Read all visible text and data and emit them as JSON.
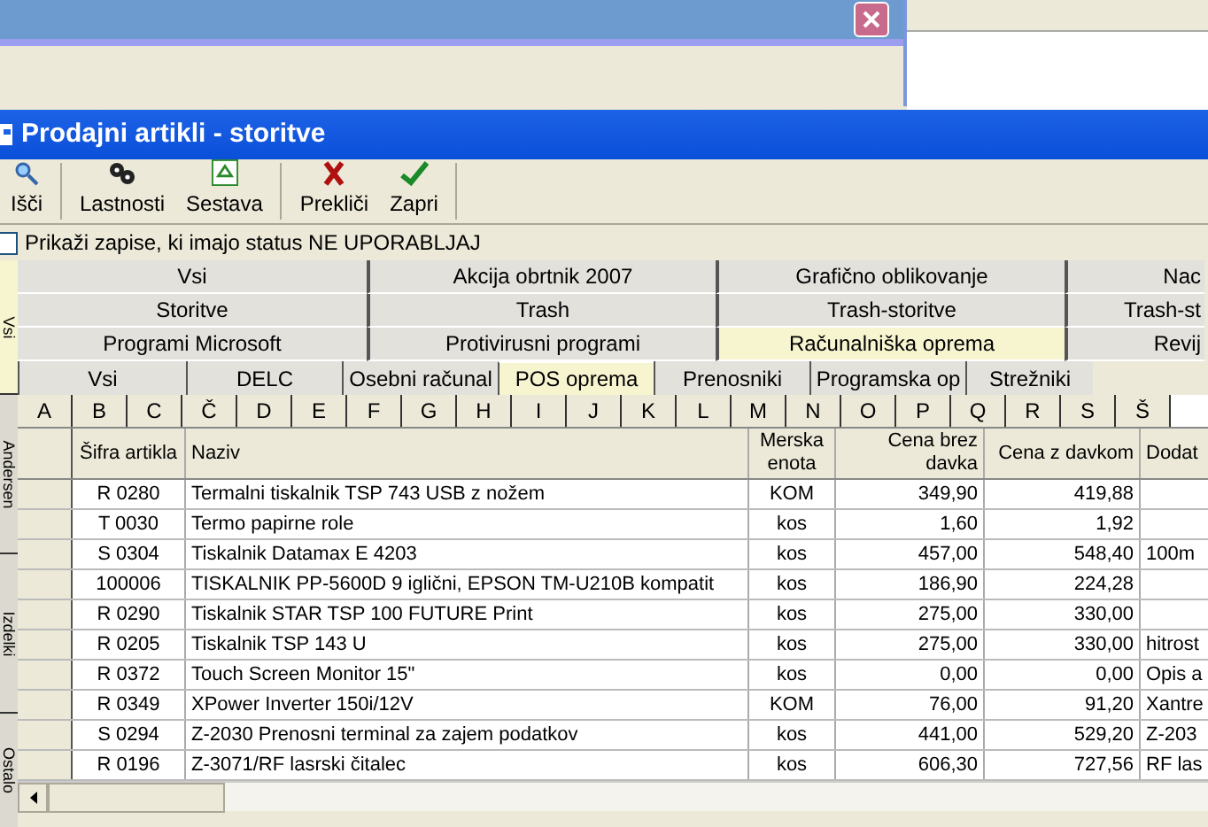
{
  "main_window": {
    "title": "Prodajni artikli - storitve"
  },
  "toolbar": [
    {
      "label": "Išči",
      "kind": "search"
    },
    {
      "label": "Lastnosti",
      "kind": "props"
    },
    {
      "label": "Sestava",
      "kind": "compose"
    },
    {
      "label": "Prekliči",
      "kind": "cancel"
    },
    {
      "label": "Zapri",
      "kind": "confirm"
    }
  ],
  "filter": {
    "label": "Prikaži zapise, ki imajo status NE UPORABLJAJ",
    "checked": false
  },
  "side_tabs": [
    {
      "label": "Vsi",
      "selected": true
    },
    {
      "label": "Andersen",
      "selected": false
    },
    {
      "label": "Izdelki",
      "selected": false
    },
    {
      "label": "Ostalo",
      "selected": false
    }
  ],
  "group_tabs": [
    [
      {
        "label": "Vsi",
        "selected": false
      },
      {
        "label": "Akcija obrtnik 2007",
        "selected": false
      },
      {
        "label": "Grafično oblikovanje",
        "selected": false
      },
      {
        "label": "Nac",
        "selected": false
      }
    ],
    [
      {
        "label": "Storitve",
        "selected": false
      },
      {
        "label": "Trash",
        "selected": false
      },
      {
        "label": "Trash-storitve",
        "selected": false
      },
      {
        "label": "Trash-st",
        "selected": false
      }
    ],
    [
      {
        "label": "Programi Microsoft",
        "selected": false
      },
      {
        "label": "Protivirusni programi",
        "selected": false
      },
      {
        "label": "Računalniška oprema",
        "selected": true
      },
      {
        "label": "Revij",
        "selected": false
      }
    ]
  ],
  "sub_tabs": [
    {
      "label": "Vsi",
      "selected": false
    },
    {
      "label": "DELC",
      "selected": false
    },
    {
      "label": "Osebni računal",
      "selected": false
    },
    {
      "label": "POS oprema",
      "selected": true
    },
    {
      "label": "Prenosniki",
      "selected": false
    },
    {
      "label": "Programska op",
      "selected": false
    },
    {
      "label": "Strežniki",
      "selected": false
    }
  ],
  "letters": [
    "A",
    "B",
    "C",
    "Č",
    "D",
    "E",
    "F",
    "G",
    "H",
    "I",
    "J",
    "K",
    "L",
    "M",
    "N",
    "O",
    "P",
    "Q",
    "R",
    "S",
    "Š"
  ],
  "table": {
    "columns": [
      "Šifra artikla",
      "Naziv",
      "Merska enota",
      "Cena brez davka",
      "Cena z davkom",
      "Dodat"
    ],
    "rows": [
      [
        "R 0280",
        "Termalni tiskalnik TSP 743 USB z nožem",
        "KOM",
        "349,90",
        "419,88",
        ""
      ],
      [
        "T 0030",
        "Termo papirne role",
        "kos",
        "1,60",
        "1,92",
        ""
      ],
      [
        "S 0304",
        "Tiskalnik Datamax E 4203",
        "kos",
        "457,00",
        "548,40",
        "100m"
      ],
      [
        "100006",
        "TISKALNIK PP-5600D 9 iglični, EPSON TM-U210B kompatit",
        "kos",
        "186,90",
        "224,28",
        ""
      ],
      [
        "R 0290",
        "Tiskalnik STAR TSP 100 FUTURE Print",
        "kos",
        "275,00",
        "330,00",
        ""
      ],
      [
        "R 0205",
        "Tiskalnik TSP 143 U",
        "kos",
        "275,00",
        "330,00",
        "hitrost"
      ],
      [
        "R 0372",
        "Touch Screen Monitor 15\"",
        "kos",
        "0,00",
        "0,00",
        "Opis a"
      ],
      [
        "R 0349",
        "XPower Inverter 150i/12V",
        "KOM",
        "76,00",
        "91,20",
        "Xantre"
      ],
      [
        "S 0294",
        "Z-2030 Prenosni terminal za zajem podatkov",
        "kos",
        "441,00",
        "529,20",
        "Z-203"
      ],
      [
        "R 0196",
        "Z-3071/RF lasrski čitalec",
        "kos",
        "606,30",
        "727,56",
        "RF las"
      ]
    ]
  }
}
